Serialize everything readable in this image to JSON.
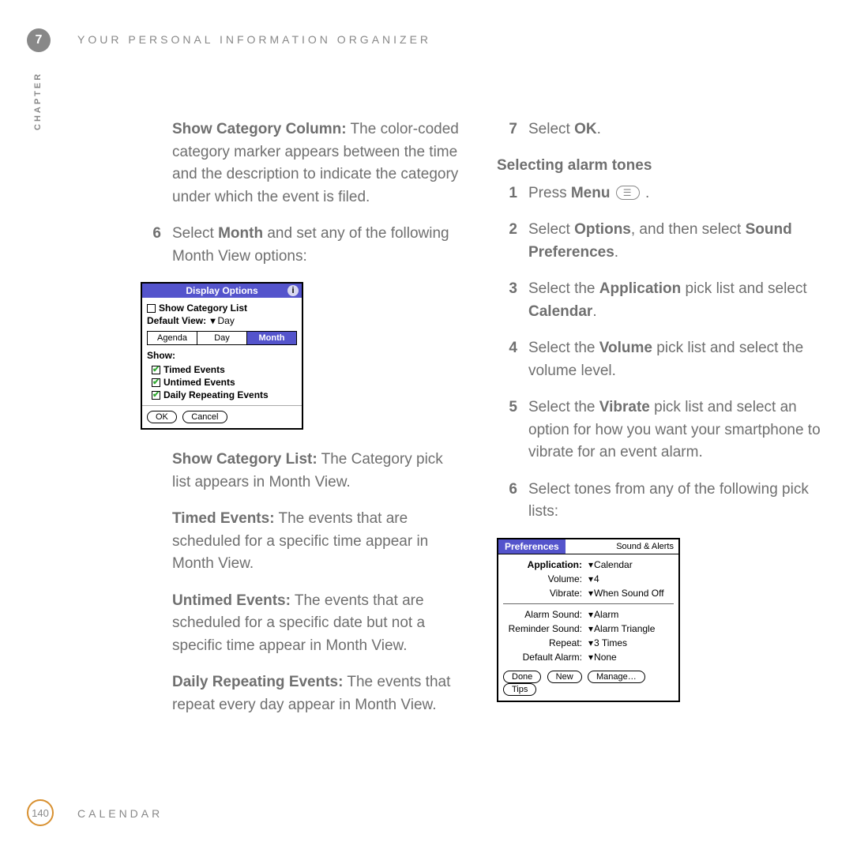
{
  "header": {
    "chapter_label": "CHAPTER",
    "chapter_number": "7",
    "running_header": "YOUR PERSONAL INFORMATION ORGANIZER"
  },
  "footer": {
    "page_number": "140",
    "section": "CALENDAR"
  },
  "left": {
    "show_cat_col_label": "Show Category Column:",
    "show_cat_col_text": " The color-coded category marker appears between the time and the description to indicate the category under which the event is filed.",
    "step6_num": "6",
    "step6_a": "Select ",
    "step6_bold": "Month",
    "step6_b": " and set any of the following Month View options:",
    "show_cat_list_label": "Show Category List:",
    "show_cat_list_text": " The Category pick list appears in Month View.",
    "timed_label": "Timed Events:",
    "timed_text": " The events that are scheduled for a specific time appear in Month View.",
    "untimed_label": "Untimed Events:",
    "untimed_text": " The events that are scheduled for a specific date but not a specific time appear in Month View.",
    "daily_label": "Daily Repeating Events:",
    "daily_text": " The events that repeat every day appear in Month View."
  },
  "right": {
    "step7_num": "7",
    "step7_a": "Select ",
    "step7_bold": "OK",
    "step7_b": ".",
    "section_title": "Selecting alarm tones",
    "s1_num": "1",
    "s1_a": "Press ",
    "s1_bold": "Menu",
    "s1_b": " .",
    "s2_num": "2",
    "s2_a": "Select ",
    "s2_bold1": "Options",
    "s2_mid": ", and then select ",
    "s2_bold2": "Sound Preferences",
    "s2_b": ".",
    "s3_num": "3",
    "s3_a": "Select the ",
    "s3_bold": "Application",
    "s3_b": " pick list and select ",
    "s3_bold2": "Calendar",
    "s3_c": ".",
    "s4_num": "4",
    "s4_a": "Select the ",
    "s4_bold": "Volume",
    "s4_b": " pick list and select the volume level.",
    "s5_num": "5",
    "s5_a": "Select the ",
    "s5_bold": "Vibrate",
    "s5_b": " pick list and select an option for how you want your smartphone to vibrate for an event alarm.",
    "s6_num": "6",
    "s6_a": "Select tones from any of the following pick lists:"
  },
  "dialog1": {
    "title": "Display Options",
    "info_icon": "i",
    "show_cat_list": "Show Category List",
    "default_view_label": "Default View:",
    "default_view_value": "Day",
    "tabs": [
      "Agenda",
      "Day",
      "Month"
    ],
    "active_tab": 2,
    "show_label": "Show:",
    "opts": [
      "Timed Events",
      "Untimed Events",
      "Daily Repeating Events"
    ],
    "ok": "OK",
    "cancel": "Cancel"
  },
  "dialog2": {
    "title_left": "Preferences",
    "title_right": "Sound & Alerts",
    "rows1": [
      {
        "label": "Application:",
        "value": "Calendar",
        "bold": true
      },
      {
        "label": "Volume:",
        "value": "4"
      },
      {
        "label": "Vibrate:",
        "value": "When Sound Off"
      }
    ],
    "rows2": [
      {
        "label": "Alarm Sound:",
        "value": "Alarm"
      },
      {
        "label": "Reminder Sound:",
        "value": "Alarm Triangle"
      },
      {
        "label": "Repeat:",
        "value": "3 Times"
      },
      {
        "label": "Default Alarm:",
        "value": "None"
      }
    ],
    "buttons": [
      "Done",
      "New",
      "Manage…",
      "Tips"
    ]
  }
}
